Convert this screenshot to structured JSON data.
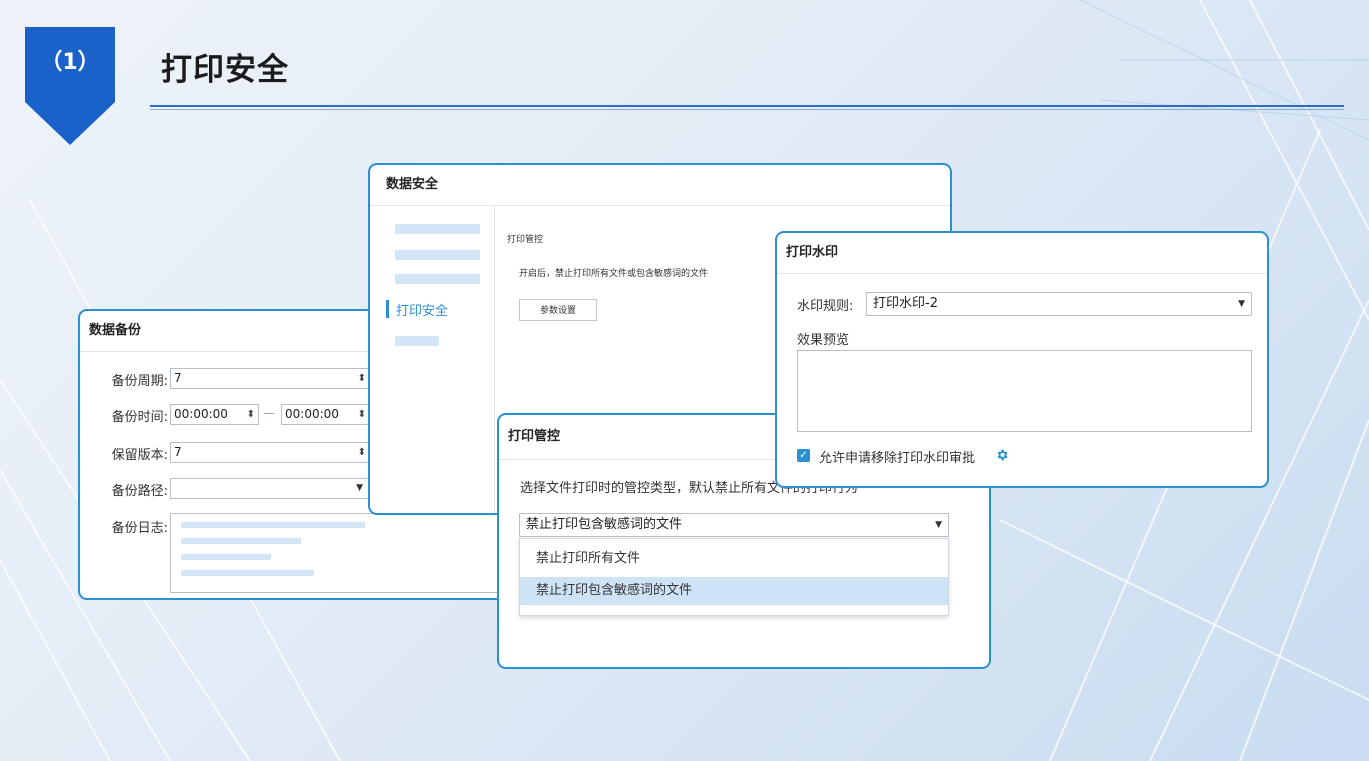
{
  "header": {
    "section_number": "（1）",
    "title": "打印安全"
  },
  "backup_panel": {
    "title": "数据备份",
    "period_label": "备份周期:",
    "period_value": "7",
    "time_label": "备份时间:",
    "time_start": "00:00:00",
    "time_sep": "—",
    "time_end": "00:00:00",
    "keep_label": "保留版本:",
    "keep_value": "7",
    "path_label": "备份路径:",
    "path_value": "",
    "log_label": "备份日志:"
  },
  "security_panel": {
    "title": "数据安全",
    "nav_active": "打印安全",
    "section_title": "打印管控",
    "description": "开启后，禁止打印所有文件或包含敏感词的文件",
    "settings_button": "参数设置"
  },
  "print_control_panel": {
    "title": "打印管控",
    "description": "选择文件打印时的管控类型，默认禁止所有文件的打印行为",
    "selected": "禁止打印包含敏感词的文件",
    "options": [
      "禁止打印所有文件",
      "禁止打印包含敏感词的文件"
    ],
    "highlighted_option": "禁止打印包含敏感词的文件"
  },
  "watermark_panel": {
    "title": "打印水印",
    "rule_label": "水印规则:",
    "rule_value": "打印水印-2",
    "preview_label": "效果预览",
    "allow_checkbox_label": "允许申请移除打印水印审批",
    "allow_checked": true
  },
  "colors": {
    "accent": "#2c8fd1",
    "brand": "#1a62c9",
    "highlight": "#cfe3f6"
  },
  "icons": {
    "caret": "caret-down-icon",
    "spinner": "spinner-arrows-icon",
    "gear": "gear-icon",
    "check": "checkbox-checked-icon"
  }
}
